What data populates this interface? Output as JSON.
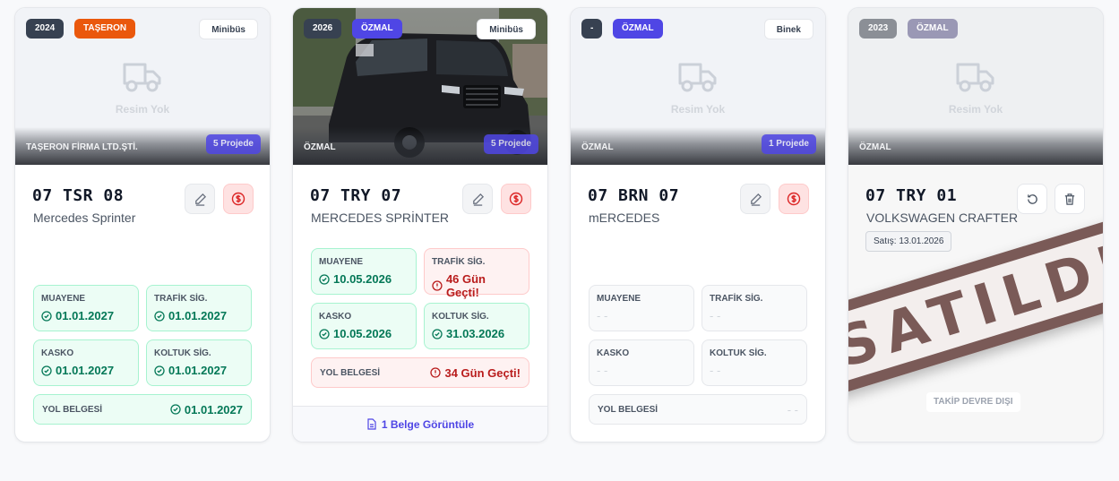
{
  "cards": [
    {
      "year": "2024",
      "ownership": "TAŞERON",
      "vehicle_type": "Minibüs",
      "no_image_text": "Resim Yok",
      "firm": "TAŞERON FİRMA LTD.ŞTİ.",
      "project_count": "5 Projede",
      "plate": "07 TSR 08",
      "model": "Mercedes Sprinter",
      "muayene_label": "MUAYENE",
      "muayene": "01.01.2027",
      "trafik_label": "TRAFİK SİG.",
      "trafik": "01.01.2027",
      "kasko_label": "KASKO",
      "kasko": "01.01.2027",
      "koltuk_label": "KOLTUK SİG.",
      "koltuk": "01.01.2027",
      "yol_label": "YOL BELGESİ",
      "yol": "01.01.2027"
    },
    {
      "year": "2026",
      "ownership": "ÖZMAL",
      "vehicle_type": "Minibüs",
      "firm": "ÖZMAL",
      "project_count": "5 Projede",
      "plate": "07 TRY 07",
      "model": "MERCEDES SPRİNTER",
      "muayene_label": "MUAYENE",
      "muayene": "10.05.2026",
      "trafik_label": "TRAFİK SİG.",
      "trafik": "46 Gün Geçti!",
      "kasko_label": "KASKO",
      "kasko": "10.05.2026",
      "koltuk_label": "KOLTUK SİG.",
      "koltuk": "31.03.2026",
      "yol_label": "YOL BELGESİ",
      "yol": "34 Gün Geçti!",
      "document_link": "1 Belge Görüntüle"
    },
    {
      "year": "-",
      "ownership": "ÖZMAL",
      "vehicle_type": "Binek",
      "no_image_text": "Resim Yok",
      "firm": "ÖZMAL",
      "project_count": "1 Projede",
      "plate": "07 BRN 07",
      "model": "mERCEDES",
      "muayene_label": "MUAYENE",
      "muayene": "- -",
      "trafik_label": "TRAFİK SİG.",
      "trafik": "- -",
      "kasko_label": "KASKO",
      "kasko": "- -",
      "koltuk_label": "KOLTUK SİG.",
      "koltuk": "- -",
      "yol_label": "YOL BELGESİ",
      "yol": "- -"
    },
    {
      "year": "2023",
      "ownership": "ÖZMAL",
      "no_image_text": "Resim Yok",
      "firm": "ÖZMAL",
      "plate": "07 TRY 01",
      "model": "VOLKSWAGEN CRAFTER",
      "sold_date": "Satış: 13.01.2026",
      "sold_stamp": "SATILDI",
      "tracking_disabled": "TAKİP DEVRE DIŞI"
    }
  ],
  "colors": {
    "ok": "#047857",
    "bad": "#b91c1c",
    "accent": "#4f46e5",
    "taseron": "#ea580c",
    "year_badge": "#374151"
  },
  "icons": [
    "truck-icon",
    "pencil-icon",
    "dollar-circle-icon",
    "check-circle-icon",
    "alert-circle-icon",
    "document-icon",
    "undo-icon",
    "trash-icon"
  ]
}
